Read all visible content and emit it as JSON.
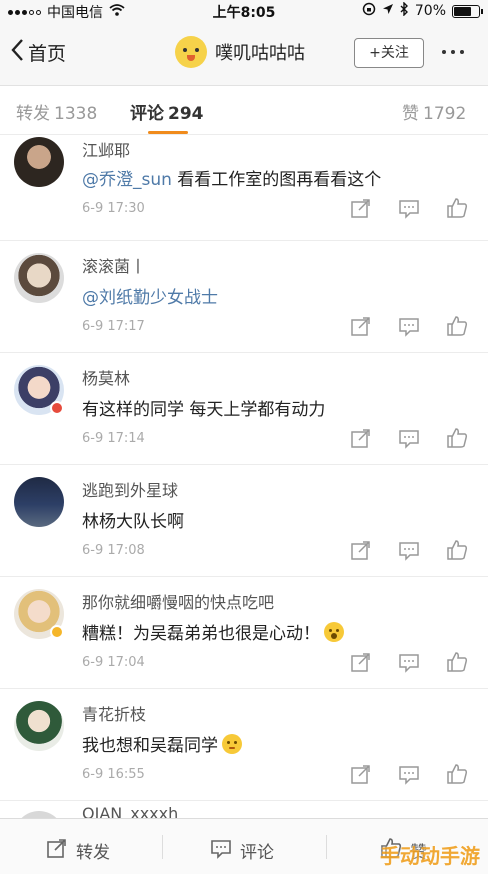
{
  "status_bar": {
    "carrier": "中国电信",
    "time": "上午8:05",
    "battery": "70%",
    "battery_level": 0.7
  },
  "nav": {
    "back_label": "首页",
    "title": "噗叽咕咕咕",
    "follow_label": "+关注"
  },
  "tabs": [
    {
      "label": "转发",
      "count": "1338"
    },
    {
      "label": "评论",
      "count": "294"
    },
    {
      "label": "赞",
      "count": "1792"
    }
  ],
  "comments": [
    {
      "name": "江邺耶",
      "mention": "@乔澄_sun",
      "text": " 看看工作室的图再看看这个",
      "time": "6-9 17:30"
    },
    {
      "name": "滚滚菌丨",
      "mention": "@刘纸勤少女战士",
      "text": "",
      "time": "6-9 17:17"
    },
    {
      "name": "杨莫林",
      "mention": "",
      "text": "有这样的同学 每天上学都有动力",
      "time": "6-9 17:14"
    },
    {
      "name": "逃跑到外星球",
      "mention": "",
      "text": "林杨大队长啊",
      "time": "6-9 17:08"
    },
    {
      "name": "那你就细嚼慢咽的快点吃吧",
      "mention": "",
      "text": "糟糕！为吴磊弟弟也很是心动！",
      "time": "6-9 17:04"
    },
    {
      "name": "青花折枝",
      "mention": "",
      "text": "我也想和吴磊同学",
      "time": "6-9 16:55"
    },
    {
      "name": "QIAN_xxxxh",
      "mention": "",
      "text": "",
      "time": ""
    }
  ],
  "bottom_bar": {
    "repost_label": "转发",
    "comment_label": "评论",
    "like_label": "赞"
  },
  "watermark": "手动动手游",
  "colors": {
    "accent": "#f08b1c",
    "mention": "#4f7aa8"
  }
}
